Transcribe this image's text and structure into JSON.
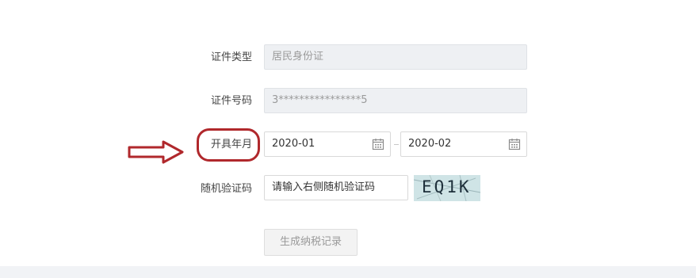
{
  "form": {
    "id_type": {
      "label": "证件类型",
      "value": "居民身份证"
    },
    "id_number": {
      "label": "证件号码",
      "value": "3****************5"
    },
    "issue_month": {
      "label": "开具年月",
      "start": "2020-01",
      "end": "2020-02"
    },
    "captcha": {
      "label": "随机验证码",
      "placeholder": "请输入右侧随机验证码",
      "image_text": "EQ1K"
    },
    "submit_label": "生成纳税记录"
  },
  "colors": {
    "highlight": "#b0282c",
    "disabled_bg": "#eef0f3",
    "captcha_bg": "#cfe4e6"
  },
  "icons": [
    "calendar-icon",
    "annotation-arrow"
  ]
}
